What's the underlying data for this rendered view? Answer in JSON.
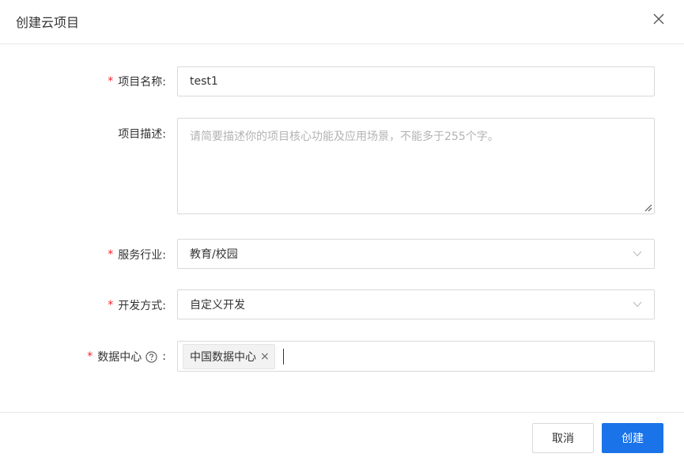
{
  "dialog": {
    "title": "创建云项目",
    "close_icon": "close-icon"
  },
  "form": {
    "name": {
      "required": "*",
      "label": "项目名称:",
      "value": "test1"
    },
    "description": {
      "label": "项目描述:",
      "placeholder": "请简要描述你的项目核心功能及应用场景，不能多于255个字。"
    },
    "industry": {
      "required": "*",
      "label": "服务行业:",
      "value": "教育/校园"
    },
    "dev_mode": {
      "required": "*",
      "label": "开发方式:",
      "value": "自定义开发"
    },
    "data_center": {
      "required": "*",
      "label": "数据中心",
      "colon": ":",
      "help_icon": "help-circle-icon",
      "tags": [
        "中国数据中心"
      ],
      "tag_remove": "×"
    }
  },
  "footer": {
    "cancel_label": "取消",
    "create_label": "创建"
  },
  "colors": {
    "primary": "#1a73e8",
    "required": "#f5222d",
    "border": "#d9d9d9"
  }
}
